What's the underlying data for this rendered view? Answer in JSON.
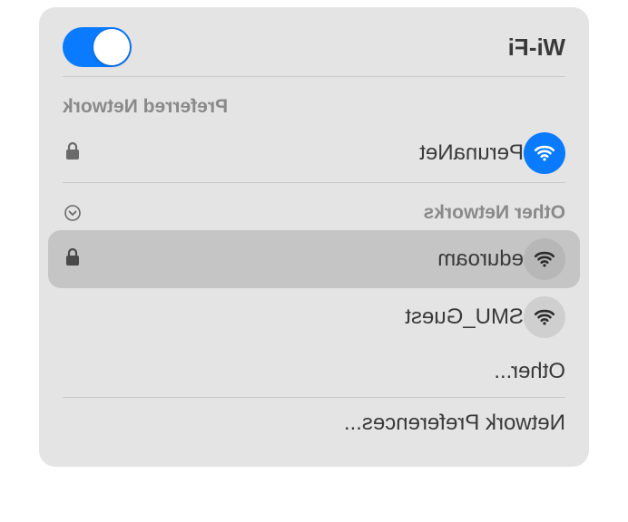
{
  "header": {
    "title": "Wi-Fi",
    "toggle_on": true
  },
  "preferred": {
    "label": "Preferred Network",
    "network": {
      "name": "PerunaNet",
      "secured": true,
      "connected": true
    }
  },
  "other": {
    "label": "Other Networks",
    "networks": [
      {
        "name": "eduroam",
        "secured": true,
        "hovered": true
      },
      {
        "name": "SMU_Guest",
        "secured": false,
        "hovered": false
      }
    ],
    "other_item": "Other..."
  },
  "footer": {
    "prefs": "Network Preferences..."
  }
}
